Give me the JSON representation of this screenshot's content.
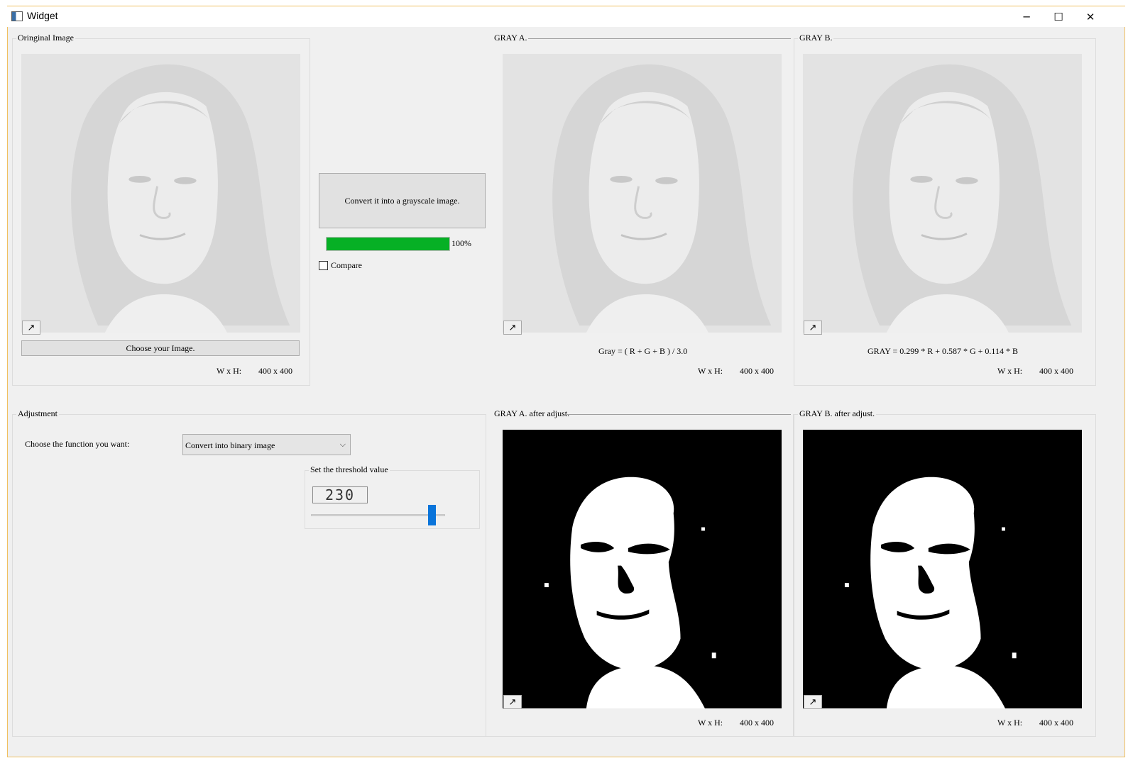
{
  "window": {
    "title": "Widget",
    "controls": {
      "minimize": "─",
      "maximize": "☐",
      "close": "✕"
    }
  },
  "original_group": {
    "title": "Oringinal Image",
    "choose_button": "Choose your Image.",
    "size_label": "W x H:",
    "size_value": "400 x 400",
    "expand_icon": "↗"
  },
  "convert": {
    "button_label": "Convert it into a grayscale image.",
    "progress_text": "100%",
    "progress_value": 1.0,
    "compare_label": "Compare",
    "compare_checked": false
  },
  "gray_a": {
    "title": "GRAY A.",
    "formula": "Gray = ( R + G + B ) / 3.0",
    "size_label": "W x H:",
    "size_value": "400 x 400",
    "expand_icon": "↗"
  },
  "gray_b": {
    "title": "GRAY B.",
    "formula": "GRAY = 0.299 * R + 0.587 * G + 0.114 * B",
    "size_label": "W x H:",
    "size_value": "400 x 400",
    "expand_icon": "↗"
  },
  "adjustment": {
    "title": "Adjustment",
    "function_label": "Choose the function you want:",
    "function_value": "Convert into binary image",
    "threshold_group_title": "Set the threshold value",
    "threshold_value": "230",
    "threshold_slider_fraction": 0.9
  },
  "gray_a_adjusted": {
    "title": "GRAY A. after adjust.",
    "size_label": "W x H:",
    "size_value": "400 x 400",
    "expand_icon": "↗"
  },
  "gray_b_adjusted": {
    "title": "GRAY B. after adjust.",
    "size_label": "W x H:",
    "size_value": "400 x 400",
    "expand_icon": "↗"
  },
  "colors": {
    "progress_fill": "#06b025",
    "slider_thumb": "#0a74da",
    "frame_accent": "#f0c060"
  }
}
